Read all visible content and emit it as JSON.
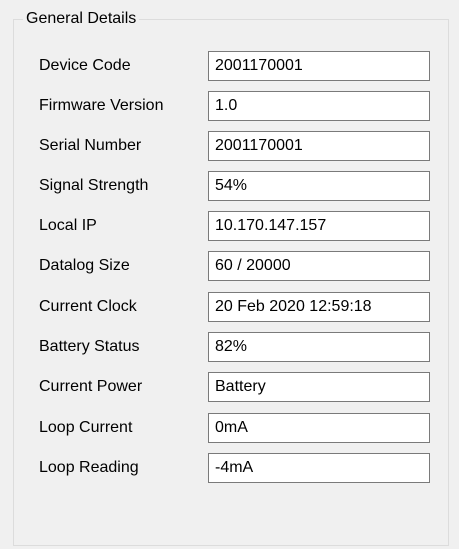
{
  "group": {
    "title": "General Details"
  },
  "fields": [
    {
      "label": "Device Code",
      "value": "2001170001"
    },
    {
      "label": "Firmware Version",
      "value": "1.0"
    },
    {
      "label": "Serial Number",
      "value": "2001170001"
    },
    {
      "label": "Signal Strength",
      "value": "54%"
    },
    {
      "label": "Local IP",
      "value": "10.170.147.157"
    },
    {
      "label": "Datalog Size",
      "value": "60 / 20000"
    },
    {
      "label": "Current Clock",
      "value": "20 Feb 2020 12:59:18"
    },
    {
      "label": "Battery Status",
      "value": "82%"
    },
    {
      "label": "Current Power",
      "value": "Battery"
    },
    {
      "label": "Loop Current",
      "value": "0mA"
    },
    {
      "label": "Loop Reading",
      "value": "-4mA"
    }
  ]
}
